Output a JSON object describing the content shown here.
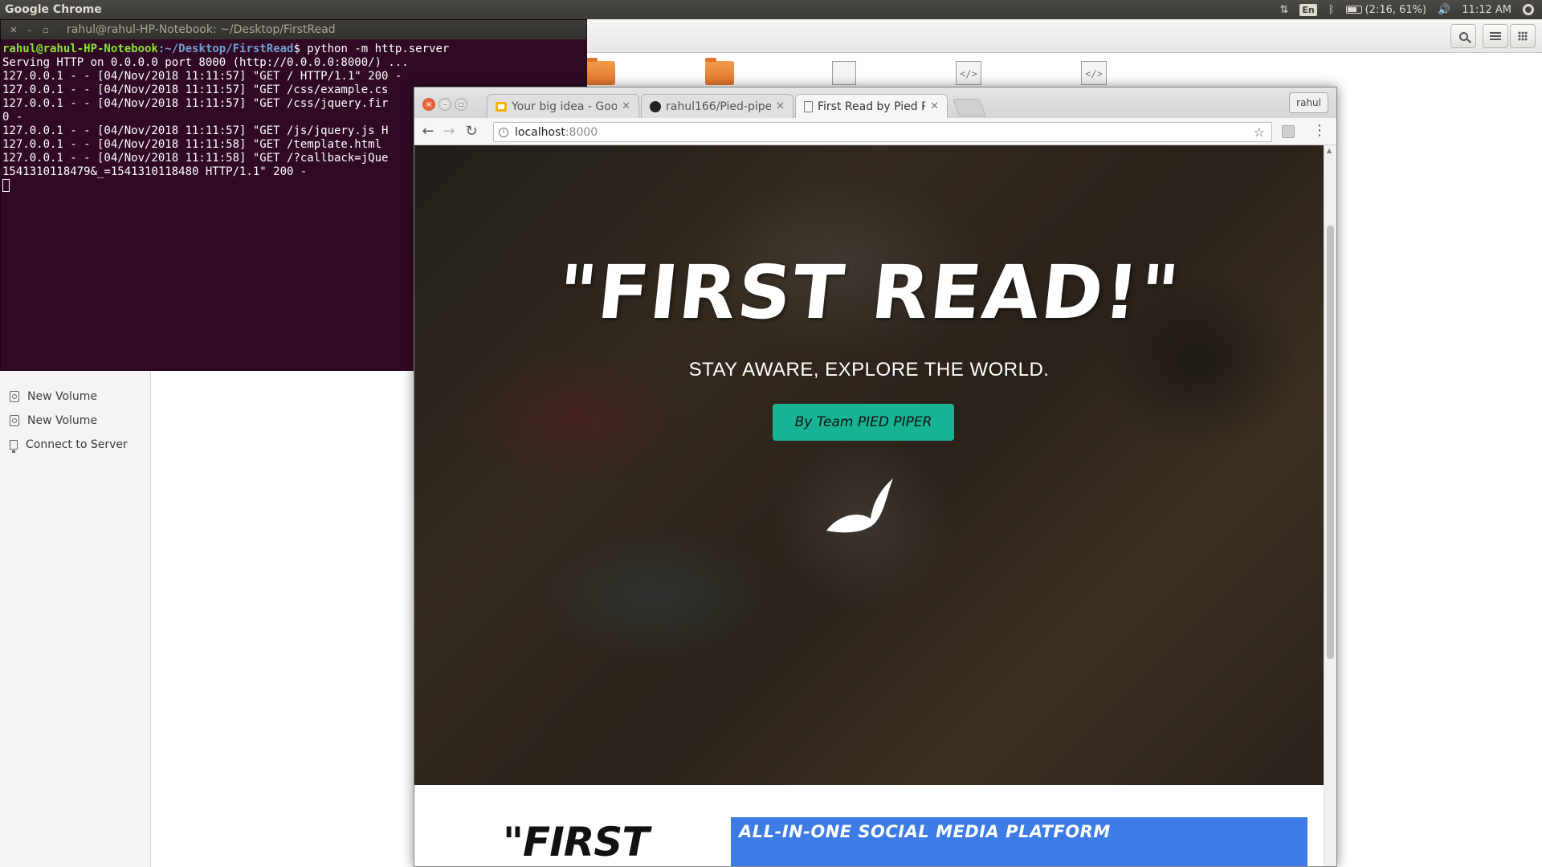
{
  "top_panel": {
    "app_title": "Google Chrome",
    "keyboard_layout": "En",
    "battery_text": "(2:16, 61%)",
    "battery_level": 0.61,
    "clock": "11:12 AM"
  },
  "nautilus": {
    "sidebar": {
      "items": [
        {
          "label": "New Volume",
          "icon": "drive-icon"
        },
        {
          "label": "New Volume",
          "icon": "drive-icon"
        },
        {
          "label": "Connect to Server",
          "icon": "server-icon"
        }
      ]
    },
    "toolbar_icons": [
      "search-icon",
      "list-view-icon",
      "grid-view-icon"
    ],
    "file_icons": [
      "folder-icon",
      "folder-icon",
      "document-icon",
      "code-file-icon",
      "code-file-icon"
    ]
  },
  "terminal": {
    "title": "rahul@rahul-HP-Notebook: ~/Desktop/FirstRead",
    "prompt_user": "rahul@rahul-HP-Notebook",
    "prompt_path": ":~/Desktop/FirstRead",
    "command": "$ python -m http.server",
    "lines": [
      "Serving HTTP on 0.0.0.0 port 8000 (http://0.0.0.0:8000/) ...",
      "127.0.0.1 - - [04/Nov/2018 11:11:57] \"GET / HTTP/1.1\" 200 -",
      "127.0.0.1 - - [04/Nov/2018 11:11:57] \"GET /css/example.cs",
      "127.0.0.1 - - [04/Nov/2018 11:11:57] \"GET /css/jquery.fir",
      "0 -",
      "127.0.0.1 - - [04/Nov/2018 11:11:57] \"GET /js/jquery.js H",
      "127.0.0.1 - - [04/Nov/2018 11:11:58] \"GET /template.html ",
      "127.0.0.1 - - [04/Nov/2018 11:11:58] \"GET /?callback=jQue",
      "1541310118479&_=1541310118480 HTTP/1.1\" 200 -"
    ]
  },
  "chrome": {
    "tabs": [
      {
        "label": "Your big idea - Goo",
        "favicon": "slides-icon",
        "active": false
      },
      {
        "label": "rahul166/Pied-pipe",
        "favicon": "github-icon",
        "active": false
      },
      {
        "label": "First Read by Pied P",
        "favicon": "page-icon",
        "active": true
      }
    ],
    "profile": "rahul",
    "url_host": "localhost",
    "url_port": ":8000",
    "page": {
      "hero_title": "\"FIRST READ!\"",
      "hero_subtitle": "STAY AWARE, EXPLORE THE WORLD.",
      "hero_button": "By Team PIED PIPER",
      "section_logo_text": "\"FIRST",
      "banner_text": "ALL-IN-ONE SOCIAL MEDIA PLATFORM",
      "accent_color": "#17b394",
      "banner_color": "#3d7be5"
    }
  }
}
